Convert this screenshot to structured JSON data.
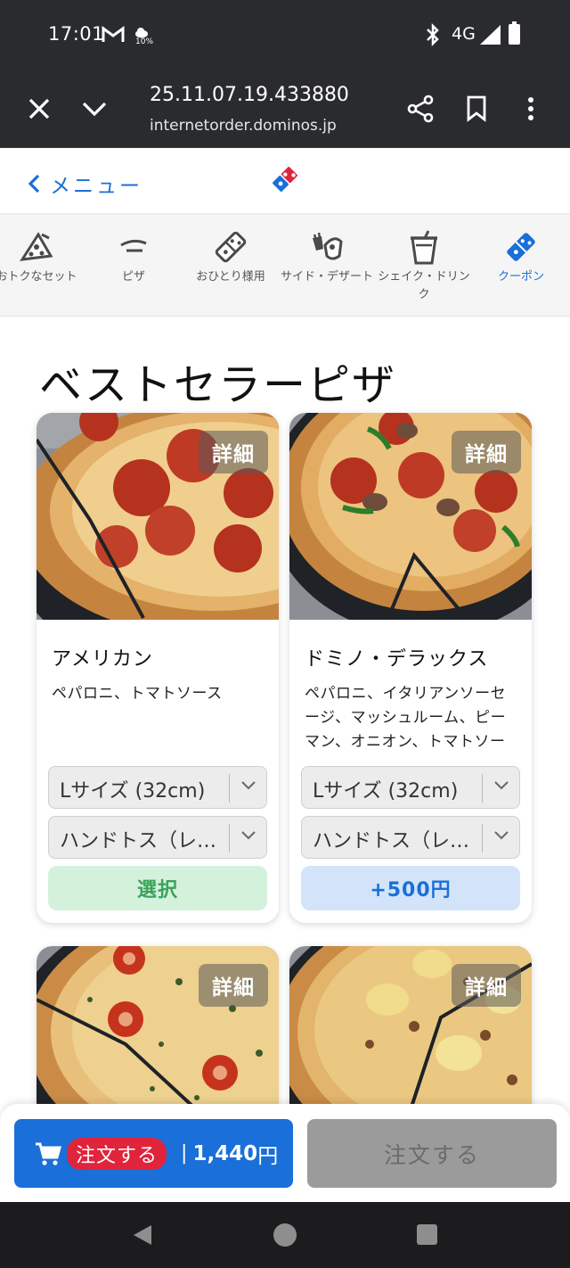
{
  "status_bar": {
    "time": "17:01",
    "weather_text": "10%",
    "network": "4G",
    "icons": [
      "mail-icon",
      "weather-icon",
      "bluetooth-icon",
      "signal-icon",
      "battery-icon"
    ]
  },
  "browser": {
    "title": "25.11.07.19.433880",
    "url": "internetorder.dominos.jp",
    "icons": [
      "close-icon",
      "chevron-down-icon",
      "share-icon",
      "bookmark-icon",
      "more-icon"
    ]
  },
  "header": {
    "back_label": "メニュー",
    "logo": "dominos-logo"
  },
  "categories": [
    {
      "label": "おトクなセット",
      "icon": "pizza-slice-icon"
    },
    {
      "label": "ピザ",
      "icon": "pizza-icon"
    },
    {
      "label": "おひとり様用",
      "icon": "dominos-tile-icon"
    },
    {
      "label": "サイド・デザート",
      "icon": "side-dessert-icon"
    },
    {
      "label": "シェイク・ドリンク",
      "icon": "drink-cup-icon"
    },
    {
      "label": "クーポン",
      "icon": "coupon-icon"
    }
  ],
  "active_category": "クーポン",
  "section": {
    "title": "ベストセラーピザ"
  },
  "products": [
    {
      "detail_label": "詳細",
      "name": "アメリカン",
      "description": "ペパロニ、トマトソース",
      "size": "Lサイズ (32cm)",
      "crust": "ハンドトス（レギュラー）",
      "button": "選択"
    },
    {
      "detail_label": "詳細",
      "name": "ドミノ・デラックス",
      "description": "ペパロニ、イタリアンソーセージ、マッシュルーム、ピーマン、オニオン、トマトソース",
      "size": "Lサイズ (32cm)",
      "crust": "ハンドトス（レギュラー）",
      "button": "+500円"
    },
    {
      "detail_label": "詳細"
    },
    {
      "detail_label": "詳細"
    }
  ],
  "order_bar": {
    "cart_pill": "注文する",
    "separator": "|",
    "total": "1,440",
    "unit": "円",
    "disabled_button": "注文する"
  },
  "colors": {
    "accent_blue": "#1a6fd8",
    "red": "#e0243b",
    "toolbar": "#2a2b2e"
  }
}
